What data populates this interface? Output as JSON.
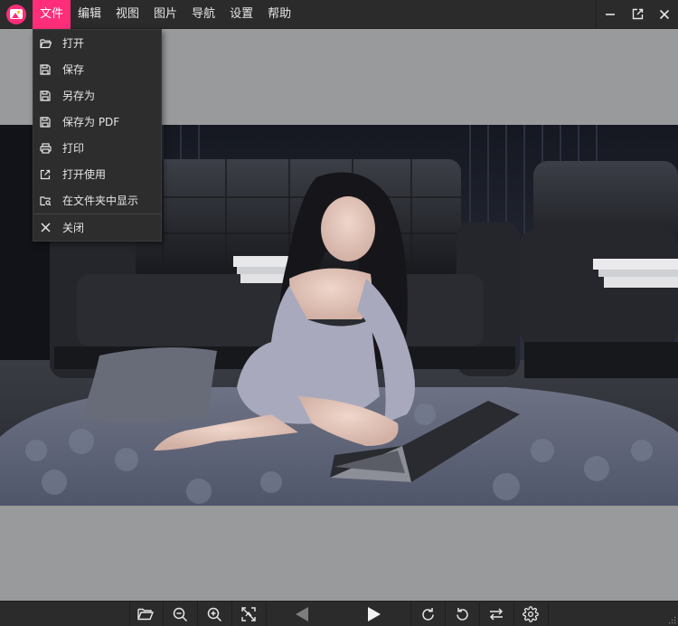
{
  "menubar": {
    "items": [
      {
        "label": "文件",
        "active": true
      },
      {
        "label": "编辑"
      },
      {
        "label": "视图"
      },
      {
        "label": "图片"
      },
      {
        "label": "导航"
      },
      {
        "label": "设置"
      },
      {
        "label": "帮助"
      }
    ]
  },
  "file_menu": {
    "items": [
      {
        "label": "打开",
        "icon": "folder-open-icon"
      },
      {
        "label": "保存",
        "icon": "floppy-disk-icon"
      },
      {
        "label": "另存为",
        "icon": "floppy-disk-icon"
      },
      {
        "label": "保存为 PDF",
        "icon": "floppy-disk-icon"
      },
      {
        "label": "打印",
        "icon": "printer-icon"
      },
      {
        "label": "打开使用",
        "icon": "external-link-icon"
      },
      {
        "label": "在文件夹中显示",
        "icon": "folder-search-icon"
      },
      {
        "label": "关闭",
        "icon": "close-icon"
      }
    ]
  },
  "window_controls": [
    "minimize-icon",
    "pop-out-icon",
    "close-icon"
  ],
  "toolbar": {
    "buttons": [
      "folder-open-icon",
      "zoom-out-icon",
      "zoom-in-icon",
      "fit-off-icon",
      "previous-icon",
      "next-icon",
      "rotate-right-icon",
      "rotate-left-icon",
      "flip-icon",
      "settings-icon"
    ]
  },
  "colors": {
    "accent": "#ff2d7a",
    "background": "#2b2b2b",
    "canvas": "#999a9c",
    "menu_bg": "#2d2d2d"
  }
}
